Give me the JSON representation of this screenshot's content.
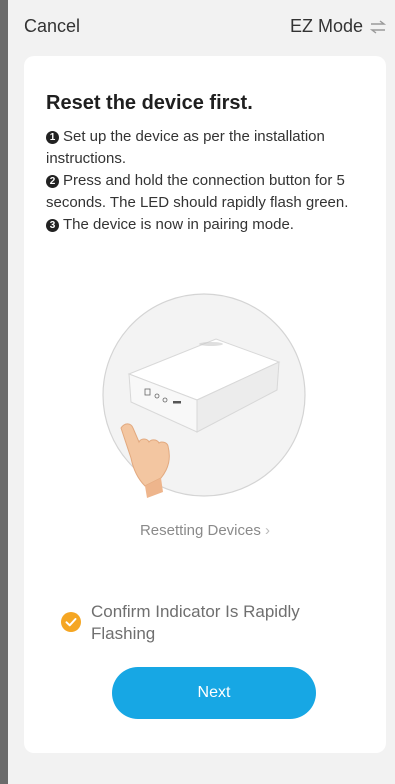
{
  "header": {
    "cancel_label": "Cancel",
    "mode_label": "EZ Mode",
    "mode_icon": "swap-arrows-icon"
  },
  "card": {
    "title": "Reset the device first.",
    "steps": [
      {
        "num": "1",
        "text": "Set up the device as per the installation instructions."
      },
      {
        "num": "2",
        "text": "Press and hold the connection button for 5 seconds. The LED should rapidly flash green."
      },
      {
        "num": "3",
        "text": "The device is now in pairing mode."
      }
    ],
    "link_label": "Resetting Devices",
    "link_icon": "chevron-right-icon",
    "confirm_label": "Confirm Indicator Is Rapidly Flashing",
    "confirm_checked": true,
    "next_label": "Next"
  },
  "colors": {
    "accent": "#17a7e4",
    "check": "#f5a623"
  }
}
